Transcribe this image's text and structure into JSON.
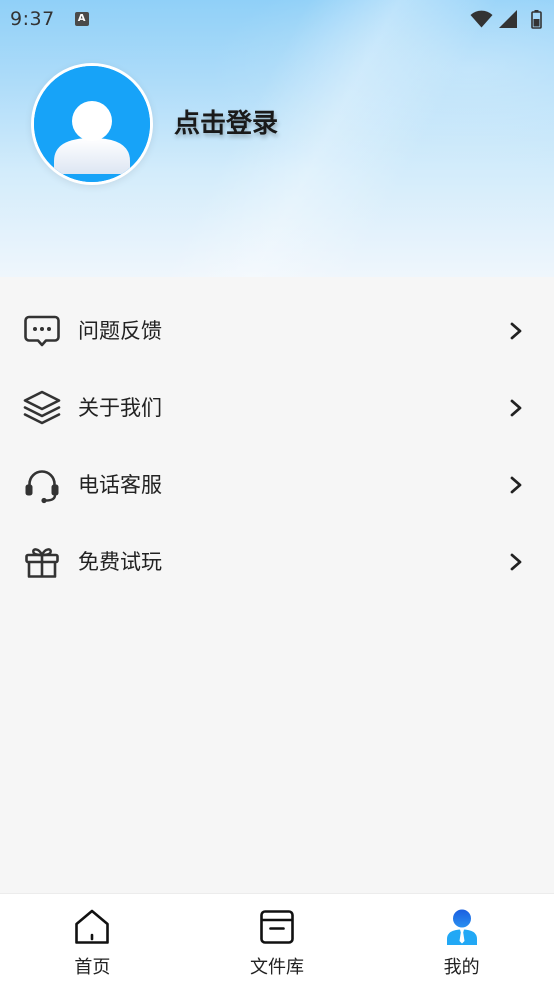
{
  "status_bar": {
    "time": "9:37",
    "badge_glyph": "A",
    "badge_icon": "a-notification-icon",
    "right_icons": [
      "wifi-icon",
      "signal-icon",
      "battery-icon"
    ]
  },
  "profile": {
    "avatar_icon": "default-avatar-icon",
    "login_label": "点击登录"
  },
  "menu": {
    "items": [
      {
        "icon": "feedback-icon",
        "label": "问题反馈"
      },
      {
        "icon": "layers-icon",
        "label": "关于我们"
      },
      {
        "icon": "headset-icon",
        "label": "电话客服"
      },
      {
        "icon": "gift-icon",
        "label": "免费试玩"
      }
    ]
  },
  "tab_bar": {
    "items": [
      {
        "icon": "home-icon",
        "label": "首页",
        "active": false
      },
      {
        "icon": "archive-box-icon",
        "label": "文件库",
        "active": false
      },
      {
        "icon": "user-icon",
        "label": "我的",
        "active": true
      }
    ]
  },
  "colors": {
    "accent": "#1e8ff0",
    "avatar_bg": "#17a3f8",
    "page_bg": "#f6f6f6",
    "text": "#222222"
  }
}
